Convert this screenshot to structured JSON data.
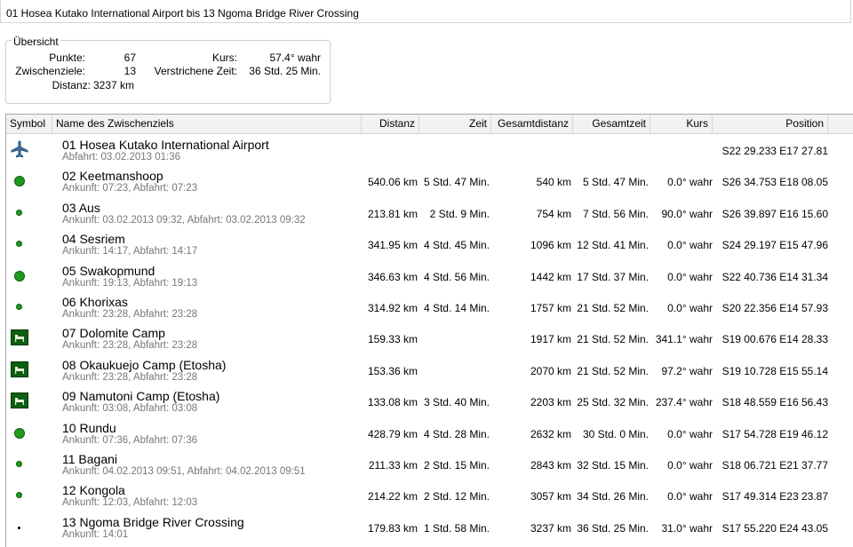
{
  "window": {
    "title": "01  Hosea Kutako International Airport bis 13 Ngoma Bridge River Crossing"
  },
  "overview": {
    "title": "Übersicht",
    "points_label": "Punkte:",
    "points_value": "67",
    "waypoints_label": "Zwischenziele:",
    "waypoints_value": "13",
    "distance_label": "Distanz:",
    "distance_value": "3237 km",
    "course_label": "Kurs:",
    "course_value": "57.4° wahr",
    "elapsed_label": "Verstrichene Zeit:",
    "elapsed_value": "36 Std. 25 Min."
  },
  "table": {
    "columns": {
      "symbol": "Symbol",
      "name": "Name des Zwischenziels",
      "distance": "Distanz",
      "time": "Zeit",
      "total_distance": "Gesamtdistanz",
      "total_time": "Gesamtzeit",
      "course": "Kurs",
      "position": "Position"
    },
    "rows": [
      {
        "symbol": "airplane-icon",
        "name": "01  Hosea Kutako International Airport",
        "detail": "Abfahrt: 03.02.2013 01:36",
        "distance": "",
        "time": "",
        "total_distance": "",
        "total_time": "",
        "course": "",
        "position": "S22 29.233 E17 27.81"
      },
      {
        "symbol": "large-dot-icon",
        "name": "02 Keetmanshoop",
        "detail": "Ankunft: 07:23, Abfahrt: 07:23",
        "distance": "540.06 km",
        "time": "5 Std. 47 Min.",
        "total_distance": "540 km",
        "total_time": "5 Std. 47 Min.",
        "course": "0.0° wahr",
        "position": "S26 34.753 E18 08.05"
      },
      {
        "symbol": "small-dot-icon",
        "name": "03 Aus",
        "detail": "Ankunft: 03.02.2013 09:32, Abfahrt: 03.02.2013 09:32",
        "distance": "213.81 km",
        "time": "2 Std. 9 Min.",
        "total_distance": "754 km",
        "total_time": "7 Std. 56 Min.",
        "course": "90.0° wahr",
        "position": "S26 39.897 E16 15.60"
      },
      {
        "symbol": "small-dot-icon",
        "name": "04 Sesriem",
        "detail": "Ankunft: 14:17, Abfahrt: 14:17",
        "distance": "341.95 km",
        "time": "4 Std. 45 Min.",
        "total_distance": "1096 km",
        "total_time": "12 Std. 41 Min.",
        "course": "0.0° wahr",
        "position": "S24 29.197 E15 47.96"
      },
      {
        "symbol": "large-dot-icon",
        "name": "05 Swakopmund",
        "detail": "Ankunft: 19:13, Abfahrt: 19:13",
        "distance": "346.63 km",
        "time": "4 Std. 56 Min.",
        "total_distance": "1442 km",
        "total_time": "17 Std. 37 Min.",
        "course": "0.0° wahr",
        "position": "S22 40.736 E14 31.34"
      },
      {
        "symbol": "small-dot-icon",
        "name": "06 Khorixas",
        "detail": "Ankunft: 23:28, Abfahrt: 23:28",
        "distance": "314.92 km",
        "time": "4 Std. 14 Min.",
        "total_distance": "1757 km",
        "total_time": "21 Std. 52 Min.",
        "course": "0.0° wahr",
        "position": "S20 22.356 E14 57.93"
      },
      {
        "symbol": "camp-icon",
        "name": "07 Dolomite Camp",
        "detail": "Ankunft: 23:28, Abfahrt: 23:28",
        "distance": "159.33 km",
        "time": "",
        "total_distance": "1917 km",
        "total_time": "21 Std. 52 Min.",
        "course": "341.1° wahr",
        "position": "S19 00.676 E14 28.33"
      },
      {
        "symbol": "camp-icon",
        "name": "08 Okaukuejo Camp (Etosha)",
        "detail": "Ankunft: 23:28, Abfahrt: 23:28",
        "distance": "153.36 km",
        "time": "",
        "total_distance": "2070 km",
        "total_time": "21 Std. 52 Min.",
        "course": "97.2° wahr",
        "position": "S19 10.728 E15 55.14"
      },
      {
        "symbol": "camp-icon",
        "name": "09 Namutoni Camp (Etosha)",
        "detail": "Ankunft: 03:08, Abfahrt: 03:08",
        "distance": "133.08 km",
        "time": "3 Std. 40 Min.",
        "total_distance": "2203 km",
        "total_time": "25 Std. 32 Min.",
        "course": "237.4° wahr",
        "position": "S18 48.559 E16 56.43"
      },
      {
        "symbol": "large-dot-icon",
        "name": "10 Rundu",
        "detail": "Ankunft: 07:36, Abfahrt: 07:36",
        "distance": "428.79 km",
        "time": "4 Std. 28 Min.",
        "total_distance": "2632 km",
        "total_time": "30 Std. 0 Min.",
        "course": "0.0° wahr",
        "position": "S17 54.728 E19 46.12"
      },
      {
        "symbol": "small-dot-icon",
        "name": "11 Bagani",
        "detail": "Ankunft: 04.02.2013 09:51, Abfahrt: 04.02.2013 09:51",
        "distance": "211.33 km",
        "time": "2 Std. 15 Min.",
        "total_distance": "2843 km",
        "total_time": "32 Std. 15 Min.",
        "course": "0.0° wahr",
        "position": "S18 06.721 E21 37.77"
      },
      {
        "symbol": "small-dot-icon",
        "name": "12 Kongola",
        "detail": "Ankunft: 12:03, Abfahrt: 12:03",
        "distance": "214.22 km",
        "time": "2 Std. 12 Min.",
        "total_distance": "3057 km",
        "total_time": "34 Std. 26 Min.",
        "course": "0.0° wahr",
        "position": "S17 49.314 E23 23.87"
      },
      {
        "symbol": "tiny-dot-icon",
        "name": "13 Ngoma Bridge River Crossing",
        "detail": "Ankunft: 14:01",
        "distance": "179.83 km",
        "time": "1 Std. 58 Min.",
        "total_distance": "3237 km",
        "total_time": "36 Std. 25 Min.",
        "course": "31.0° wahr",
        "position": "S17 55.220 E24 43.05"
      }
    ]
  }
}
